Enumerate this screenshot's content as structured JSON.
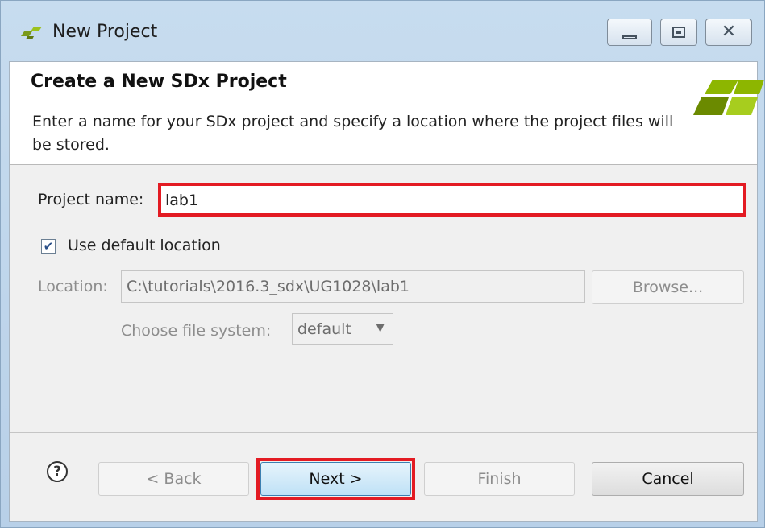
{
  "window": {
    "title": "New Project",
    "logo_icon": "xilinx-logo-icon",
    "controls": {
      "minimize_icon": "minimize-icon",
      "maximize_icon": "maximize-icon",
      "close_icon": "close-icon",
      "close_glyph": "✕"
    }
  },
  "header": {
    "title": "Create a New SDx Project",
    "description": "Enter a name for your SDx project and specify a location where the project files will be stored.",
    "logo_icon": "xilinx-logo-icon"
  },
  "form": {
    "project_name_label": "Project name:",
    "project_name_value": "lab1",
    "use_default_label": "Use default location",
    "use_default_checked": true,
    "checkmark": "✔",
    "location_label": "Location:",
    "location_value": "C:\\tutorials\\2016.3_sdx\\UG1028\\lab1",
    "browse_label": "Browse...",
    "filesystem_label": "Choose file system:",
    "filesystem_value": "default",
    "filesystem_arrow": "▼"
  },
  "footer": {
    "help_glyph": "?",
    "back_label": "< Back",
    "next_label": "Next >",
    "finish_label": "Finish",
    "cancel_label": "Cancel"
  },
  "colors": {
    "highlight": "#e31b23",
    "accent_green": "#8db600"
  }
}
